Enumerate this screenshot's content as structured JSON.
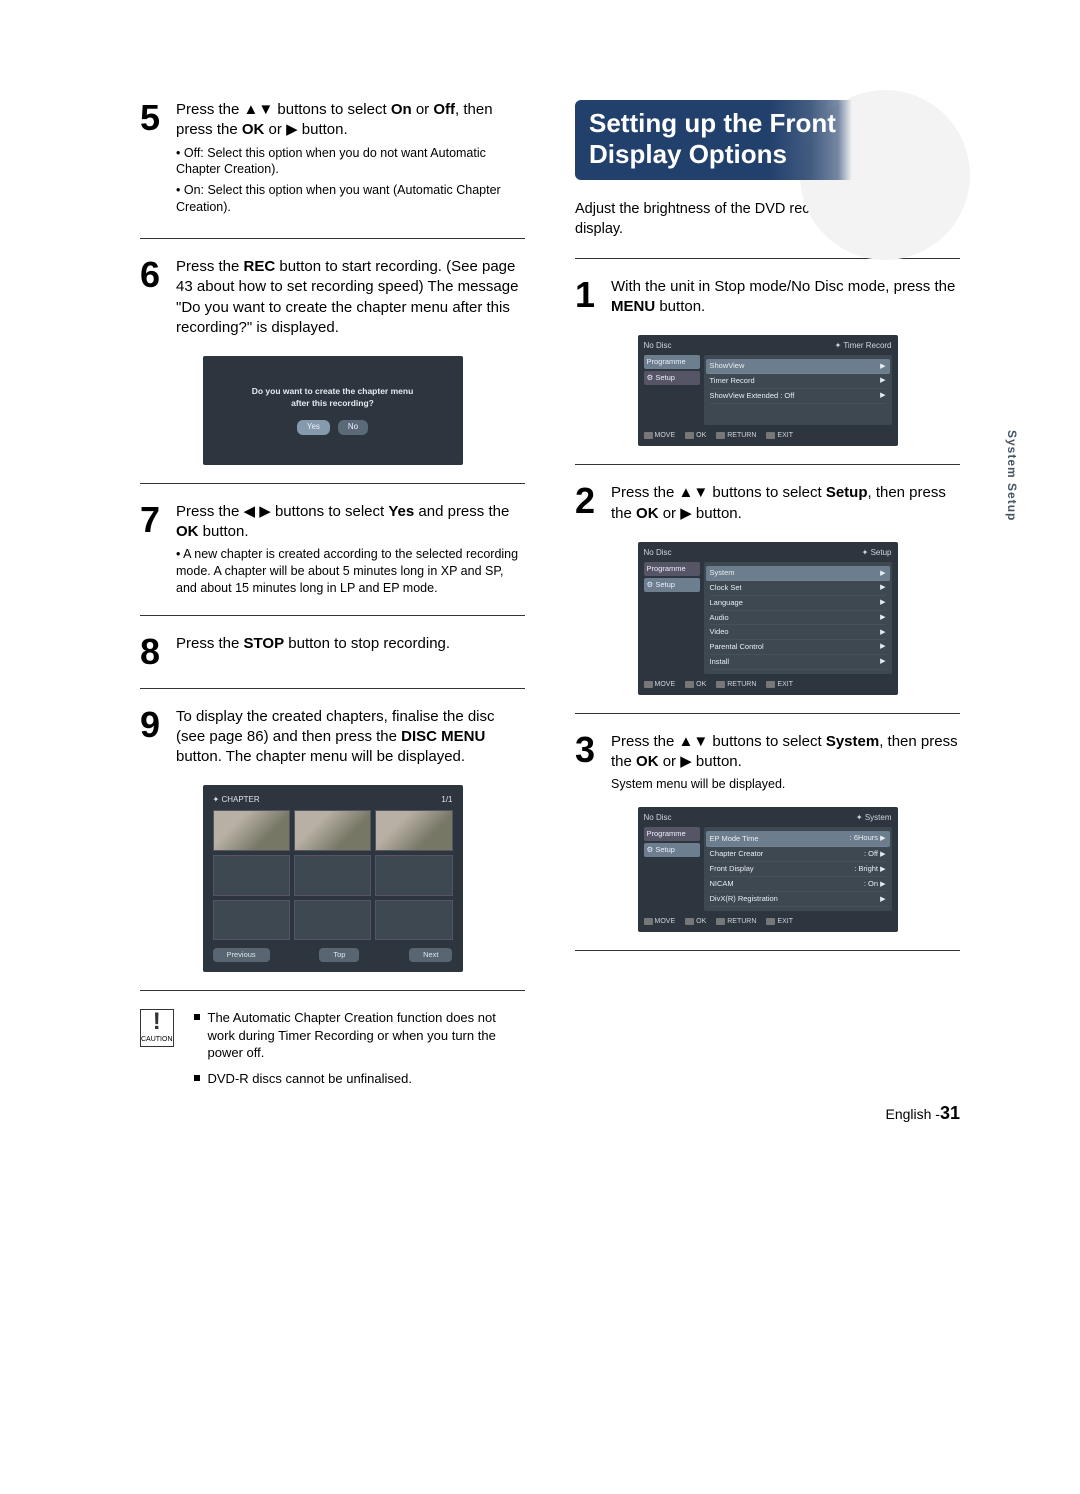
{
  "side_tab": "System Setup",
  "page_footer": {
    "lang": "English -",
    "num": "31"
  },
  "left": {
    "step5": {
      "num": "5",
      "text_a": "Press the ",
      "text_b": " buttons to select ",
      "on": "On",
      "or": " or ",
      "off": "Off",
      "text_c": ", then press the ",
      "ok": "OK",
      "text_d": " or ",
      "text_e": " button.",
      "sub_off": "• Off:  Select this option when you do not want Automatic Chapter Creation).",
      "sub_on": "• On:  Select this option when you want (Automatic Chapter Creation)."
    },
    "step6": {
      "num": "6",
      "text_a": "Press the ",
      "rec": "REC",
      "text_b": " button to start recording. (See page 43 about how to set recording speed) The message \"Do you want to create the chapter menu after this recording?\" is displayed.",
      "dialog_msg1": "Do you want to create the chapter menu",
      "dialog_msg2": "after this recording?",
      "btn_yes": "Yes",
      "btn_no": "No"
    },
    "step7": {
      "num": "7",
      "text_a": "Press the ",
      "text_b": " buttons to select ",
      "yes": "Yes",
      "text_c": " and press the ",
      "ok": "OK",
      "text_d": " button.",
      "sub": "• A new chapter is created according to the selected recording mode. A chapter will be about 5 minutes long in XP and SP, and about 15 minutes long in LP and EP mode."
    },
    "step8": {
      "num": "8",
      "text_a": "Press the ",
      "stop": "STOP",
      "text_b": " button to stop recording."
    },
    "step9": {
      "num": "9",
      "text_a": "To display the created chapters, finalise the disc (see page 86) and then press the ",
      "disc_menu": "DISC MENU",
      "text_b": " button. The chapter menu will be displayed.",
      "chapter_label": "CHAPTER",
      "chapter_page": "1/1",
      "nav_prev": "Previous",
      "nav_top": "Top",
      "nav_next": "Next"
    },
    "caution": {
      "label": "CAUTION",
      "item1": "The Automatic Chapter Creation function does not work during Timer Recording or when you turn the power off.",
      "item2": "DVD-R discs cannot be unfinalised."
    }
  },
  "right": {
    "heading1": "Setting up the Front",
    "heading2": "Display Options",
    "intro": "Adjust the brightness of the DVD recorder front panel display.",
    "step1": {
      "num": "1",
      "text_a": "With the unit in Stop mode/No Disc mode, press the ",
      "menu": "MENU",
      "text_b": " button.",
      "osd": {
        "no_disc": "No Disc",
        "mode": "Timer Record",
        "side_prog": "Programme",
        "side_setup": "Setup",
        "row1": "ShowView",
        "row2": "Timer Record",
        "row3": "ShowView Extended : Off",
        "f_move": "MOVE",
        "f_ok": "OK",
        "f_return": "RETURN",
        "f_exit": "EXIT"
      }
    },
    "step2": {
      "num": "2",
      "text_a": "Press the ",
      "text_b": " buttons to select ",
      "setup": "Setup",
      "text_c": ", then press the ",
      "ok": "OK",
      "text_d": " or ",
      "text_e": " button.",
      "osd": {
        "no_disc": "No Disc",
        "mode": "Setup",
        "side_prog": "Programme",
        "side_setup": "Setup",
        "row1": "System",
        "row2": "Clock Set",
        "row3": "Language",
        "row4": "Audio",
        "row5": "Video",
        "row6": "Parental Control",
        "row7": "Install",
        "f_move": "MOVE",
        "f_ok": "OK",
        "f_return": "RETURN",
        "f_exit": "EXIT"
      }
    },
    "step3": {
      "num": "3",
      "text_a": "Press the ",
      "text_b": " buttons to select ",
      "system": "System",
      "text_c": ", then press the ",
      "ok": "OK",
      "text_d": " or ",
      "text_e": " button.",
      "sub": "System menu will be displayed.",
      "osd": {
        "no_disc": "No Disc",
        "mode": "System",
        "side_prog": "Programme",
        "side_setup": "Setup",
        "row1l": "EP Mode Time",
        "row1r": ": 6Hours",
        "row2l": "Chapter Creator",
        "row2r": ": Off",
        "row3l": "Front Display",
        "row3r": ": Bright",
        "row4l": "NICAM",
        "row4r": ": On",
        "row5l": "DivX(R) Registration",
        "row5r": "",
        "f_move": "MOVE",
        "f_ok": "OK",
        "f_return": "RETURN",
        "f_exit": "EXIT"
      }
    }
  }
}
